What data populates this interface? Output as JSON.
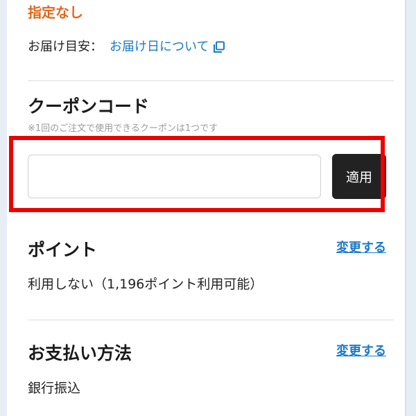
{
  "delivery": {
    "specified": "指定なし",
    "eta_label": "お届け目安：",
    "eta_link": "お届け日について"
  },
  "coupon": {
    "title": "クーポンコード",
    "note": "※1回のご注文で使用できるクーポンは1つです",
    "input_value": "",
    "input_placeholder": "",
    "apply_label": "適用"
  },
  "points": {
    "title": "ポイント",
    "change_label": "変更する",
    "value": "利用しない（1,196ポイント利用可能）"
  },
  "payment": {
    "title": "お支払い方法",
    "change_label": "変更する",
    "value": "銀行振込"
  },
  "colors": {
    "accent_orange": "#e0661b",
    "link_blue": "#1b79c9",
    "highlight_red": "#ee0000",
    "button_dark": "#222222",
    "page_background": "#e6edf5"
  },
  "icons": {
    "eta_link_icon": "copy-icon"
  }
}
